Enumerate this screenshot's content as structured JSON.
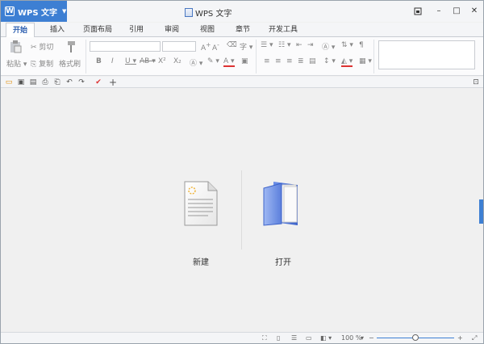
{
  "app": {
    "button_label": "WPS 文字",
    "window_title": "WPS 文字"
  },
  "tabs": [
    {
      "label": "开始",
      "active": true
    },
    {
      "label": "插入"
    },
    {
      "label": "页面布局"
    },
    {
      "label": "引用"
    },
    {
      "label": "审阅"
    },
    {
      "label": "视图"
    },
    {
      "label": "章节"
    },
    {
      "label": "开发工具"
    }
  ],
  "ribbon": {
    "paste_label": "粘贴",
    "cut_label": "剪切",
    "copy_label": "复制",
    "format_painter_label": "格式刷",
    "bold": "B",
    "italic": "I",
    "underline": "U",
    "strikethrough": "AB",
    "superscript": "X²",
    "subscript": "X₂"
  },
  "main": {
    "new_label": "新建",
    "open_label": "打开"
  },
  "status": {
    "zoom": "100 %",
    "zoom_level": 0.5,
    "minus": "−",
    "plus": "+"
  },
  "colors": {
    "accent": "#3d7fd3",
    "tab_active_text": "#2d5fb0"
  }
}
